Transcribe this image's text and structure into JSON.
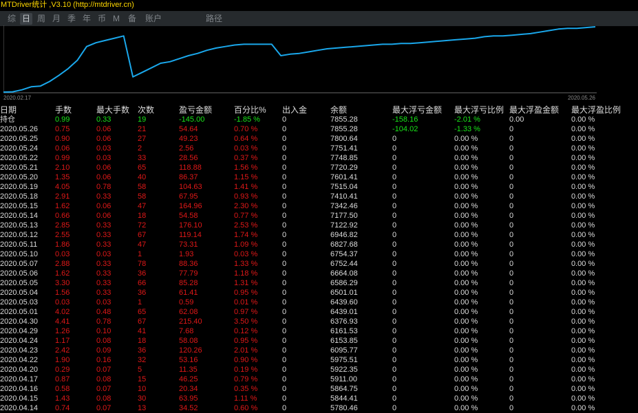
{
  "window": {
    "title": "MTDriver统计 ,V3.10 (http://mtdriver.cn)"
  },
  "tabs": [
    {
      "label": "综",
      "active": false
    },
    {
      "label": "日",
      "active": true
    },
    {
      "label": "周",
      "active": false
    },
    {
      "label": "月",
      "active": false
    },
    {
      "label": "季",
      "active": false
    },
    {
      "label": "年",
      "active": false
    },
    {
      "label": "币",
      "active": false
    },
    {
      "label": "M",
      "active": false
    },
    {
      "label": "备",
      "active": false
    },
    {
      "label": "账户",
      "active": false
    },
    {
      "label": "路径",
      "active": false
    }
  ],
  "colors": {
    "line": "#1aa8ec",
    "axis": "#6a6a6a",
    "text_white": "#dcdcdc",
    "text_red": "#e01818",
    "text_green": "#19e619",
    "text_yellow": "#ffd800",
    "date_label": "#8a8a8a"
  },
  "chart_data": {
    "type": "line",
    "x_start": "2020.02.17",
    "x_end": "2020.05.26",
    "series": [
      {
        "values": [
          0.0,
          0.2,
          1.5,
          3.5,
          4.0,
          7.0,
          11.0,
          15.5,
          21.0,
          30.0,
          32.5,
          34.0,
          35.5,
          37.0,
          10.0,
          13.0,
          16.0,
          19.0,
          20.0,
          22.0,
          24.0,
          25.5,
          27.5,
          29.0,
          30.0,
          31.0,
          31.5,
          31.5,
          31.5,
          31.5,
          24.0,
          25.0,
          25.5,
          26.5,
          27.5,
          28.5,
          29.0,
          29.5,
          30.0,
          30.5,
          31.0,
          31.5,
          31.5,
          32.0,
          32.0,
          32.5,
          33.0,
          33.5,
          34.0,
          34.5,
          35.0,
          35.5,
          36.5,
          37.0,
          37.0,
          37.5,
          38.0,
          38.5,
          39.5,
          40.5,
          41.5,
          42.0,
          42.0,
          42.5,
          43.0
        ]
      }
    ]
  },
  "table": {
    "headers": [
      "日期",
      "手数",
      "最大手数",
      "次数",
      "盈亏金额",
      "百分比%",
      "出入金",
      "余额",
      "最大浮亏金额",
      "最大浮亏比例",
      "最大浮盈金额",
      "最大浮盈比例"
    ],
    "summary": [
      "持仓",
      "0.99",
      "0.33",
      "19",
      "-145.00",
      "-1.85 %",
      "0",
      "7855.28",
      "-158.16",
      "-2.01 %",
      "0.00",
      "0.00 %"
    ],
    "rows": [
      [
        "2020.05.26",
        "0.75",
        "0.06",
        "21",
        "54.64",
        "0.70 %",
        "0",
        "7855.28",
        "-104.02",
        "-1.33 %",
        "0",
        "0.00 %"
      ],
      [
        "2020.05.25",
        "0.90",
        "0.06",
        "27",
        "49.23",
        "0.64 %",
        "0",
        "7800.64",
        "0",
        "0.00 %",
        "0",
        "0.00 %"
      ],
      [
        "2020.05.24",
        "0.06",
        "0.03",
        "2",
        "2.56",
        "0.03 %",
        "0",
        "7751.41",
        "0",
        "0.00 %",
        "0",
        "0.00 %"
      ],
      [
        "2020.05.22",
        "0.99",
        "0.03",
        "33",
        "28.56",
        "0.37 %",
        "0",
        "7748.85",
        "0",
        "0.00 %",
        "0",
        "0.00 %"
      ],
      [
        "2020.05.21",
        "2.10",
        "0.06",
        "65",
        "118.88",
        "1.56 %",
        "0",
        "7720.29",
        "0",
        "0.00 %",
        "0",
        "0.00 %"
      ],
      [
        "2020.05.20",
        "1.35",
        "0.06",
        "40",
        "86.37",
        "1.15 %",
        "0",
        "7601.41",
        "0",
        "0.00 %",
        "0",
        "0.00 %"
      ],
      [
        "2020.05.19",
        "4.05",
        "0.78",
        "58",
        "104.63",
        "1.41 %",
        "0",
        "7515.04",
        "0",
        "0.00 %",
        "0",
        "0.00 %"
      ],
      [
        "2020.05.18",
        "2.91",
        "0.33",
        "58",
        "67.95",
        "0.93 %",
        "0",
        "7410.41",
        "0",
        "0.00 %",
        "0",
        "0.00 %"
      ],
      [
        "2020.05.15",
        "1.62",
        "0.06",
        "47",
        "164.96",
        "2.30 %",
        "0",
        "7342.46",
        "0",
        "0.00 %",
        "0",
        "0.00 %"
      ],
      [
        "2020.05.14",
        "0.66",
        "0.06",
        "18",
        "54.58",
        "0.77 %",
        "0",
        "7177.50",
        "0",
        "0.00 %",
        "0",
        "0.00 %"
      ],
      [
        "2020.05.13",
        "2.85",
        "0.33",
        "72",
        "176.10",
        "2.53 %",
        "0",
        "7122.92",
        "0",
        "0.00 %",
        "0",
        "0.00 %"
      ],
      [
        "2020.05.12",
        "2.55",
        "0.33",
        "67",
        "119.14",
        "1.74 %",
        "0",
        "6946.82",
        "0",
        "0.00 %",
        "0",
        "0.00 %"
      ],
      [
        "2020.05.11",
        "1.86",
        "0.33",
        "47",
        "73.31",
        "1.09 %",
        "0",
        "6827.68",
        "0",
        "0.00 %",
        "0",
        "0.00 %"
      ],
      [
        "2020.05.10",
        "0.03",
        "0.03",
        "1",
        "1.93",
        "0.03 %",
        "0",
        "6754.37",
        "0",
        "0.00 %",
        "0",
        "0.00 %"
      ],
      [
        "2020.05.07",
        "2.88",
        "0.33",
        "78",
        "88.36",
        "1.33 %",
        "0",
        "6752.44",
        "0",
        "0.00 %",
        "0",
        "0.00 %"
      ],
      [
        "2020.05.06",
        "1.62",
        "0.33",
        "36",
        "77.79",
        "1.18 %",
        "0",
        "6664.08",
        "0",
        "0.00 %",
        "0",
        "0.00 %"
      ],
      [
        "2020.05.05",
        "3.30",
        "0.33",
        "66",
        "85.28",
        "1.31 %",
        "0",
        "6586.29",
        "0",
        "0.00 %",
        "0",
        "0.00 %"
      ],
      [
        "2020.05.04",
        "1.56",
        "0.33",
        "36",
        "61.41",
        "0.95 %",
        "0",
        "6501.01",
        "0",
        "0.00 %",
        "0",
        "0.00 %"
      ],
      [
        "2020.05.03",
        "0.03",
        "0.03",
        "1",
        "0.59",
        "0.01 %",
        "0",
        "6439.60",
        "0",
        "0.00 %",
        "0",
        "0.00 %"
      ],
      [
        "2020.05.01",
        "4.02",
        "0.48",
        "65",
        "62.08",
        "0.97 %",
        "0",
        "6439.01",
        "0",
        "0.00 %",
        "0",
        "0.00 %"
      ],
      [
        "2020.04.30",
        "4.41",
        "0.78",
        "67",
        "215.40",
        "3.50 %",
        "0",
        "6376.93",
        "0",
        "0.00 %",
        "0",
        "0.00 %"
      ],
      [
        "2020.04.29",
        "1.26",
        "0.10",
        "41",
        "7.68",
        "0.12 %",
        "0",
        "6161.53",
        "0",
        "0.00 %",
        "0",
        "0.00 %"
      ],
      [
        "2020.04.24",
        "1.17",
        "0.08",
        "18",
        "58.08",
        "0.95 %",
        "0",
        "6153.85",
        "0",
        "0.00 %",
        "0",
        "0.00 %"
      ],
      [
        "2020.04.23",
        "2.42",
        "0.09",
        "36",
        "120.26",
        "2.01 %",
        "0",
        "6095.77",
        "0",
        "0.00 %",
        "0",
        "0.00 %"
      ],
      [
        "2020.04.22",
        "1.90",
        "0.16",
        "32",
        "53.16",
        "0.90 %",
        "0",
        "5975.51",
        "0",
        "0.00 %",
        "0",
        "0.00 %"
      ],
      [
        "2020.04.20",
        "0.29",
        "0.07",
        "5",
        "11.35",
        "0.19 %",
        "0",
        "5922.35",
        "0",
        "0.00 %",
        "0",
        "0.00 %"
      ],
      [
        "2020.04.17",
        "0.87",
        "0.08",
        "15",
        "46.25",
        "0.79 %",
        "0",
        "5911.00",
        "0",
        "0.00 %",
        "0",
        "0.00 %"
      ],
      [
        "2020.04.16",
        "0.58",
        "0.07",
        "10",
        "20.34",
        "0.35 %",
        "0",
        "5864.75",
        "0",
        "0.00 %",
        "0",
        "0.00 %"
      ],
      [
        "2020.04.15",
        "1.43",
        "0.08",
        "30",
        "63.95",
        "1.11 %",
        "0",
        "5844.41",
        "0",
        "0.00 %",
        "0",
        "0.00 %"
      ],
      [
        "2020.04.14",
        "0.74",
        "0.07",
        "13",
        "34.52",
        "0.60 %",
        "0",
        "5780.46",
        "0",
        "0.00 %",
        "0",
        "0.00 %"
      ]
    ]
  }
}
